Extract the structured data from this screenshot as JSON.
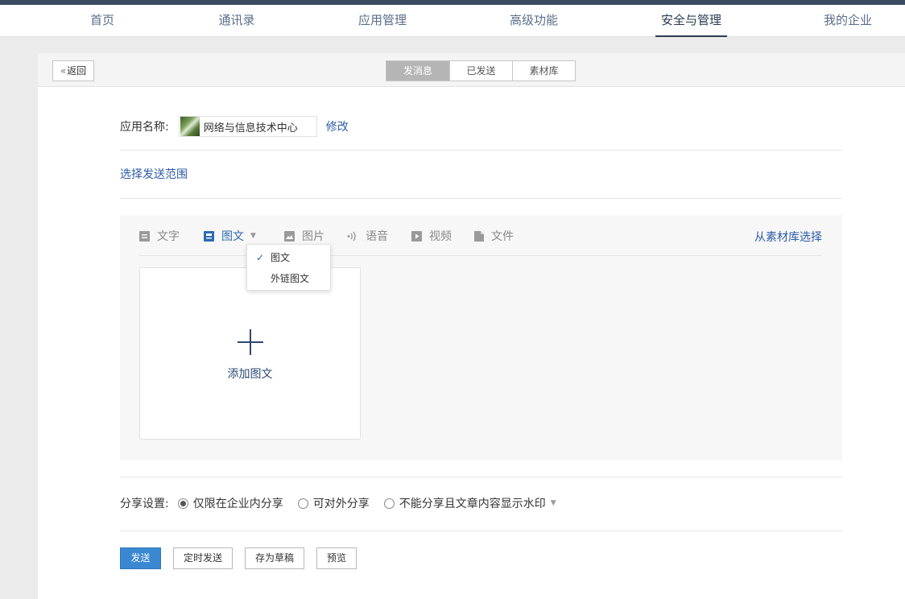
{
  "nav": {
    "items": [
      {
        "label": "首页",
        "active": false
      },
      {
        "label": "通讯录",
        "active": false
      },
      {
        "label": "应用管理",
        "active": false
      },
      {
        "label": "高级功能",
        "active": false
      },
      {
        "label": "安全与管理",
        "active": true
      },
      {
        "label": "我的企业",
        "active": false
      }
    ]
  },
  "header": {
    "back_label": "返回",
    "tabs": [
      {
        "label": "发消息",
        "active": true
      },
      {
        "label": "已发送",
        "active": false
      },
      {
        "label": "素材库",
        "active": false
      }
    ]
  },
  "app": {
    "label": "应用名称:",
    "name": "网络与信息技术中心",
    "modify_label": "修改"
  },
  "scope": {
    "label": "选择发送范围"
  },
  "editor": {
    "types": [
      {
        "label": "文字",
        "icon": "text-icon",
        "active": false
      },
      {
        "label": "图文",
        "icon": "news-icon",
        "active": true
      },
      {
        "label": "图片",
        "icon": "image-icon",
        "active": false
      },
      {
        "label": "语音",
        "icon": "voice-icon",
        "active": false
      },
      {
        "label": "视频",
        "icon": "video-icon",
        "active": false
      },
      {
        "label": "文件",
        "icon": "file-icon",
        "active": false
      }
    ],
    "library_link": "从素材库选择",
    "add_label": "添加图文",
    "dropdown": {
      "items": [
        {
          "label": "图文",
          "checked": true
        },
        {
          "label": "外链图文",
          "checked": false
        }
      ]
    }
  },
  "share": {
    "label": "分享设置:",
    "options": [
      {
        "label": "仅限在企业内分享",
        "selected": true
      },
      {
        "label": "可对外分享",
        "selected": false
      },
      {
        "label": "不能分享且文章内容显示水印",
        "selected": false
      }
    ]
  },
  "actions": {
    "send": "发送",
    "schedule": "定时发送",
    "draft": "存为草稿",
    "preview": "预览"
  },
  "colors": {
    "accent": "#2e5ba8",
    "primary_button": "#3b88d2",
    "topbar": "#3a4a61"
  }
}
